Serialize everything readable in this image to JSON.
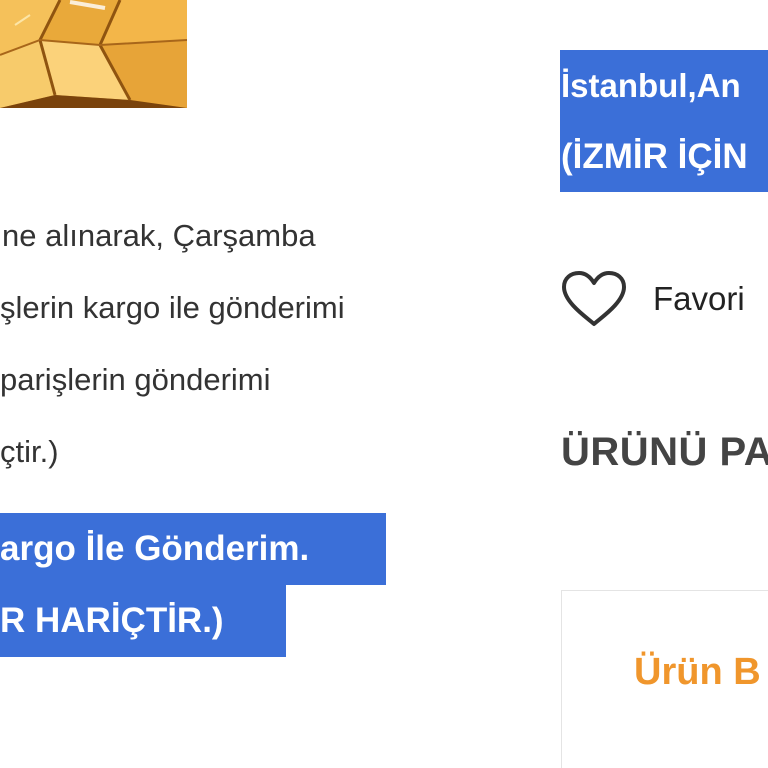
{
  "product_image": {
    "alt": "baklava-image",
    "icon": "baklava-photo"
  },
  "description": {
    "lines": [
      "ne alınarak, Çarşamba",
      "şlerin kargo ile gönderimi",
      "parişlerin gönderimi",
      "çtir.)"
    ]
  },
  "highlight_left": {
    "line1": "argo İle Gönderim.",
    "line2": "R HARİÇTİR.)"
  },
  "highlight_right": {
    "line1": "İstanbul,An",
    "line2": "(İZMİR İÇİN"
  },
  "favorite": {
    "label": "Favori",
    "icon": "heart-icon"
  },
  "share": {
    "heading": "ÜRÜNÜ PA"
  },
  "info_box": {
    "title": "Ürün B"
  },
  "colors": {
    "highlight_bg": "#3b6fd8",
    "accent_orange": "#f0962c",
    "text": "#333333"
  }
}
